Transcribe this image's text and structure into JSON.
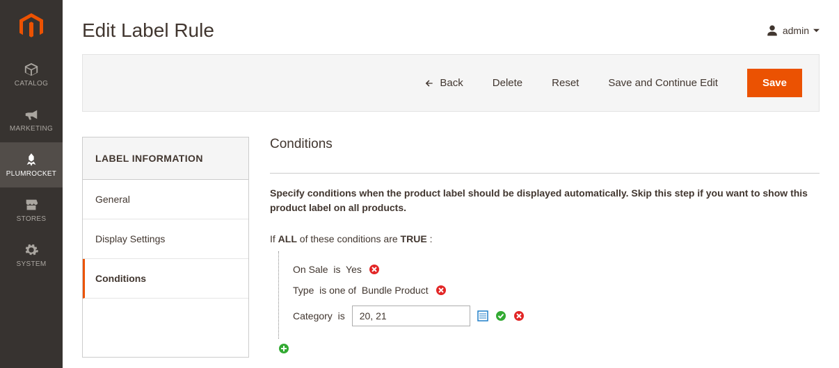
{
  "header": {
    "title": "Edit Label Rule",
    "user_label": "admin"
  },
  "nav": {
    "items": [
      {
        "label": "CATALOG"
      },
      {
        "label": "MARKETING"
      },
      {
        "label": "PLUMROCKET"
      },
      {
        "label": "STORES"
      },
      {
        "label": "SYSTEM"
      }
    ]
  },
  "actions": {
    "back": "Back",
    "delete": "Delete",
    "reset": "Reset",
    "save_continue": "Save and Continue Edit",
    "save": "Save"
  },
  "side_tabs": {
    "header": "LABEL INFORMATION",
    "items": [
      {
        "label": "General"
      },
      {
        "label": "Display Settings"
      },
      {
        "label": "Conditions"
      }
    ],
    "active_index": 2
  },
  "panel": {
    "title": "Conditions",
    "intro": "Specify conditions when the product label should be displayed automatically. Skip this step if you want to show this product label on all products.",
    "root_prefix": "If ",
    "root_agg": "ALL",
    "root_mid": " of these conditions are ",
    "root_bool": "TRUE",
    "root_suffix": " :",
    "rules": [
      {
        "attr": "On Sale",
        "op": "is",
        "val": "Yes",
        "editing": false
      },
      {
        "attr": "Type",
        "op": "is one of",
        "val": "Bundle Product",
        "editing": false
      },
      {
        "attr": "Category",
        "op": "is",
        "val": "20, 21",
        "editing": true
      }
    ]
  }
}
